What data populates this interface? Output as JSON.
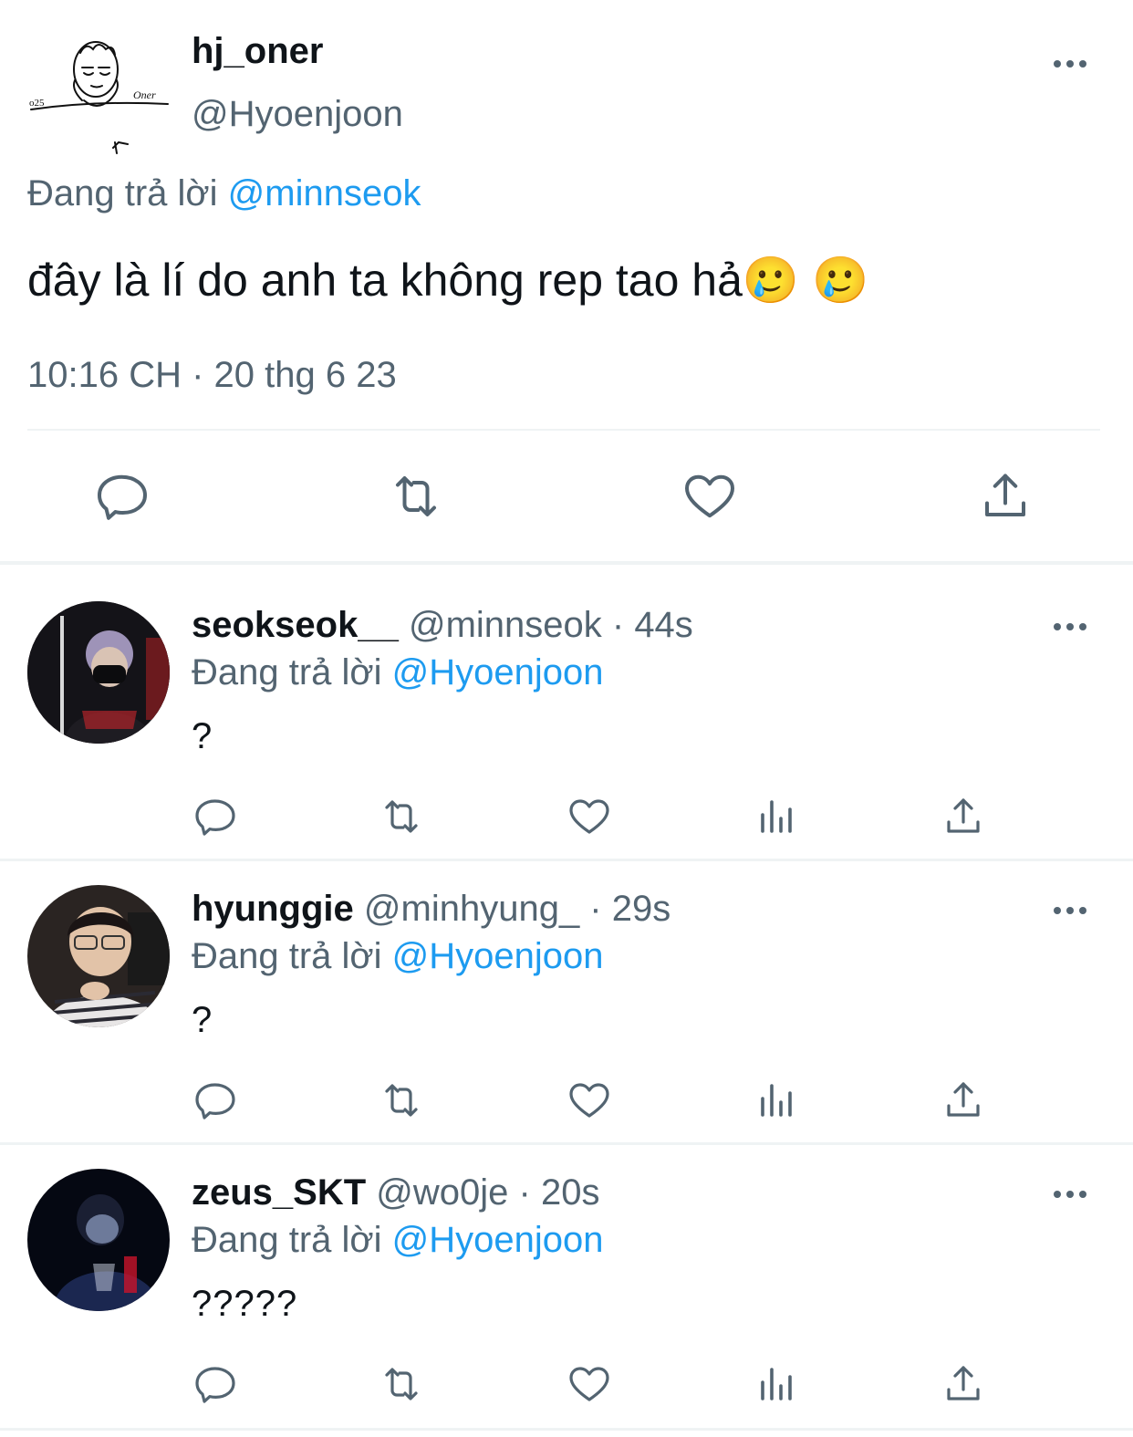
{
  "main_tweet": {
    "display_name": "hj_oner",
    "handle": "@Hyoenjoon",
    "reply_prefix": "Đang trả lời",
    "reply_to": "@minnseok",
    "text": "đây là lí do anh ta không rep tao hả",
    "emojis": "🥲 🥲",
    "timestamp": "10:16 CH · 20 thg 6 23",
    "avatar_doodle_text_left": "o25",
    "avatar_doodle_text_right": "Oner"
  },
  "replies": [
    {
      "display_name": "seokseok__",
      "meta": "@minnseok · 44s",
      "reply_prefix": "Đang trả lời",
      "reply_to": "@Hyoenjoon",
      "text": "?"
    },
    {
      "display_name": "hyunggie",
      "meta": "@minhyung_ · 29s",
      "reply_prefix": "Đang trả lời",
      "reply_to": "@Hyoenjoon",
      "text": "?"
    },
    {
      "display_name": "zeus_SKT",
      "meta": "@wo0je · 20s",
      "reply_prefix": "Đang trả lời",
      "reply_to": "@Hyoenjoon",
      "text": "?????"
    }
  ],
  "colors": {
    "text": "#0f1419",
    "secondary": "#536471",
    "link": "#1d9bf0",
    "divider": "#eff3f4"
  },
  "icons": [
    "more-icon",
    "reply-icon",
    "retweet-icon",
    "like-icon",
    "share-icon",
    "analytics-icon"
  ]
}
